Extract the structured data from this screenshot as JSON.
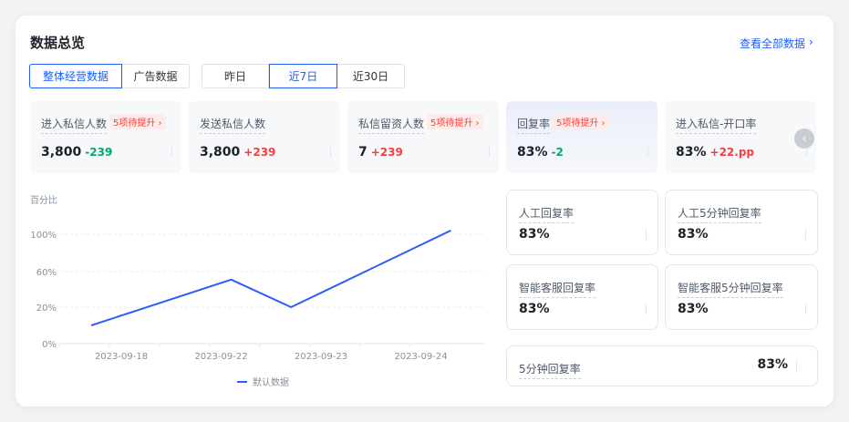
{
  "header": {
    "title": "数据总览",
    "view_all": "查看全部数据"
  },
  "data_tabs": [
    {
      "label": "整体经营数据",
      "active": true
    },
    {
      "label": "广告数据",
      "active": false
    }
  ],
  "range_tabs": [
    {
      "label": "昨日",
      "active": false
    },
    {
      "label": "近7日",
      "active": true
    },
    {
      "label": "近30日",
      "active": false
    }
  ],
  "metrics": [
    {
      "label": "进入私信人数",
      "badge": "5项待提升 ›",
      "value": "3,800",
      "delta": "-239",
      "dir": "down"
    },
    {
      "label": "发送私信人数",
      "badge": "",
      "value": "3,800",
      "delta": "+239",
      "dir": "up"
    },
    {
      "label": "私信留资人数",
      "badge": "5项待提升 ›",
      "value": "7",
      "delta": "+239",
      "dir": "up"
    },
    {
      "label": "回复率",
      "badge": "5项待提升 ›",
      "value": "83%",
      "delta": "-2",
      "dir": "down"
    },
    {
      "label": "进入私信-开口率",
      "badge": "",
      "value": "83%",
      "delta": "+22.pp",
      "dir": "up"
    }
  ],
  "rate_cards": [
    {
      "label": "人工回复率",
      "value": "83%"
    },
    {
      "label": "人工5分钟回复率",
      "value": "83%"
    },
    {
      "label": "智能客服回复率",
      "value": "83%"
    },
    {
      "label": "智能客服5分钟回复率",
      "value": "83%"
    },
    {
      "label": "5分钟回复率",
      "value": "83%"
    }
  ],
  "chart_data": {
    "type": "line",
    "ylabel": "百分比",
    "y_ticks": [
      "0%",
      "20%",
      "60%",
      "100%"
    ],
    "y_tick_values": [
      0,
      20,
      60,
      100
    ],
    "categories": [
      "2023-09-18",
      "2023-09-22",
      "2023-09-23",
      "2023-09-24"
    ],
    "series": [
      {
        "name": "默认数据",
        "color": "#2e5bff",
        "x": [
          -0.3,
          1.1,
          1.7,
          3.3
        ],
        "values": [
          10,
          51,
          20,
          104
        ]
      }
    ],
    "legend": "bottom-center",
    "grid": true
  }
}
